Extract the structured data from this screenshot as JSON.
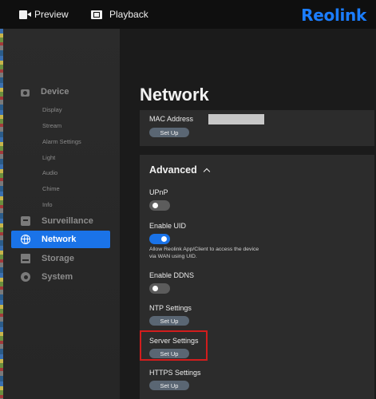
{
  "topbar": {
    "preview_label": "Preview",
    "playback_label": "Playback",
    "brand": "Reolink"
  },
  "sidebar": {
    "device": "Device",
    "device_items": [
      "Display",
      "Stream",
      "Alarm Settings",
      "Light",
      "Audio",
      "Chime",
      "Info"
    ],
    "surveillance": "Surveillance",
    "network": "Network",
    "storage": "Storage",
    "system": "System"
  },
  "main": {
    "title": "Network",
    "mac": {
      "label": "MAC Address",
      "button": "Set Up"
    },
    "advanced": {
      "title": "Advanced",
      "upnp": {
        "label": "UPnP",
        "enabled": false
      },
      "uid": {
        "label": "Enable UID",
        "enabled": true,
        "description_line1": "Allow Reolink App/Client to access the device",
        "description_line2": "via WAN using UID."
      },
      "ddns": {
        "label": "Enable DDNS",
        "enabled": false
      },
      "ntp": {
        "label": "NTP Settings",
        "button": "Set Up"
      },
      "server": {
        "label": "Server Settings",
        "button": "Set Up",
        "highlighted": true
      },
      "https": {
        "label": "HTTPS Settings",
        "button": "Set Up"
      }
    }
  },
  "colors": {
    "accent": "#1a73e8",
    "brand": "#1b7dff",
    "highlight": "#d21d1d"
  }
}
